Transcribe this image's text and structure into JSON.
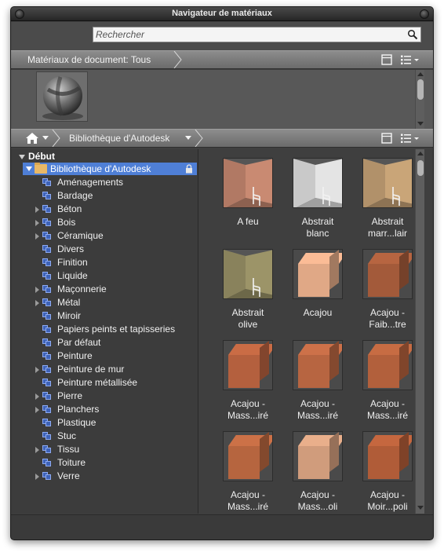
{
  "window": {
    "title": "Navigateur de matériaux"
  },
  "search": {
    "placeholder": "Rechercher"
  },
  "document_materials": {
    "label": "Matériaux de document: Tous"
  },
  "library_header": {
    "crumb": "Bibliothèque d'Autodesk"
  },
  "tree": {
    "root_label": "Début",
    "library_label": "Bibliothèque d'Autodesk",
    "items": [
      {
        "label": "Aménagements",
        "expandable": false
      },
      {
        "label": "Bardage",
        "expandable": false
      },
      {
        "label": "Béton",
        "expandable": true
      },
      {
        "label": "Bois",
        "expandable": true
      },
      {
        "label": "Céramique",
        "expandable": true
      },
      {
        "label": "Divers",
        "expandable": false
      },
      {
        "label": "Finition",
        "expandable": false
      },
      {
        "label": "Liquide",
        "expandable": false
      },
      {
        "label": "Maçonnerie",
        "expandable": true
      },
      {
        "label": "Métal",
        "expandable": true
      },
      {
        "label": "Miroir",
        "expandable": false
      },
      {
        "label": "Papiers peints et tapisseries",
        "expandable": false
      },
      {
        "label": "Par défaut",
        "expandable": false
      },
      {
        "label": "Peinture",
        "expandable": false
      },
      {
        "label": "Peinture de mur",
        "expandable": true
      },
      {
        "label": "Peinture métallisée",
        "expandable": false
      },
      {
        "label": "Pierre",
        "expandable": true
      },
      {
        "label": "Planchers",
        "expandable": true
      },
      {
        "label": "Plastique",
        "expandable": false
      },
      {
        "label": "Stuc",
        "expandable": false
      },
      {
        "label": "Tissu",
        "expandable": true
      },
      {
        "label": "Toiture",
        "expandable": false
      },
      {
        "label": "Verre",
        "expandable": true
      }
    ]
  },
  "materials": [
    {
      "line1": "A feu",
      "line2": "",
      "kind": "wall",
      "color": "#c98a72"
    },
    {
      "line1": "Abstrait",
      "line2": "blanc",
      "kind": "wall",
      "color": "#e4e4e4"
    },
    {
      "line1": "Abstrait",
      "line2": "marr...lair",
      "kind": "wall",
      "color": "#c9a578"
    },
    {
      "line1": "Abstrait",
      "line2": "olive",
      "kind": "wall",
      "color": "#9c9468"
    },
    {
      "line1": "Acajou",
      "line2": "",
      "kind": "cube",
      "color": "#e0a886"
    },
    {
      "line1": "Acajou -",
      "line2": "Faib...tre",
      "kind": "cube",
      "color": "#a35a3a"
    },
    {
      "line1": "Acajou -",
      "line2": "Mass...iré",
      "kind": "cube",
      "color": "#b4603e"
    },
    {
      "line1": "Acajou -",
      "line2": "Mass...iré",
      "kind": "cube",
      "color": "#b76541"
    },
    {
      "line1": "Acajou -",
      "line2": "Mass...iré",
      "kind": "cube",
      "color": "#b2603c"
    },
    {
      "line1": "Acajou -",
      "line2": "Mass...iré",
      "kind": "cube",
      "color": "#b6653f"
    },
    {
      "line1": "Acajou -",
      "line2": "Mass...oli",
      "kind": "cube",
      "color": "#d09c7c"
    },
    {
      "line1": "Acajou -",
      "line2": "Moir...poli",
      "kind": "cube",
      "color": "#b05c38"
    }
  ],
  "colors": {
    "window_bg": "#3f3f3f",
    "header_bar": "#7b7b7b",
    "selection": "#4f7fd6"
  }
}
